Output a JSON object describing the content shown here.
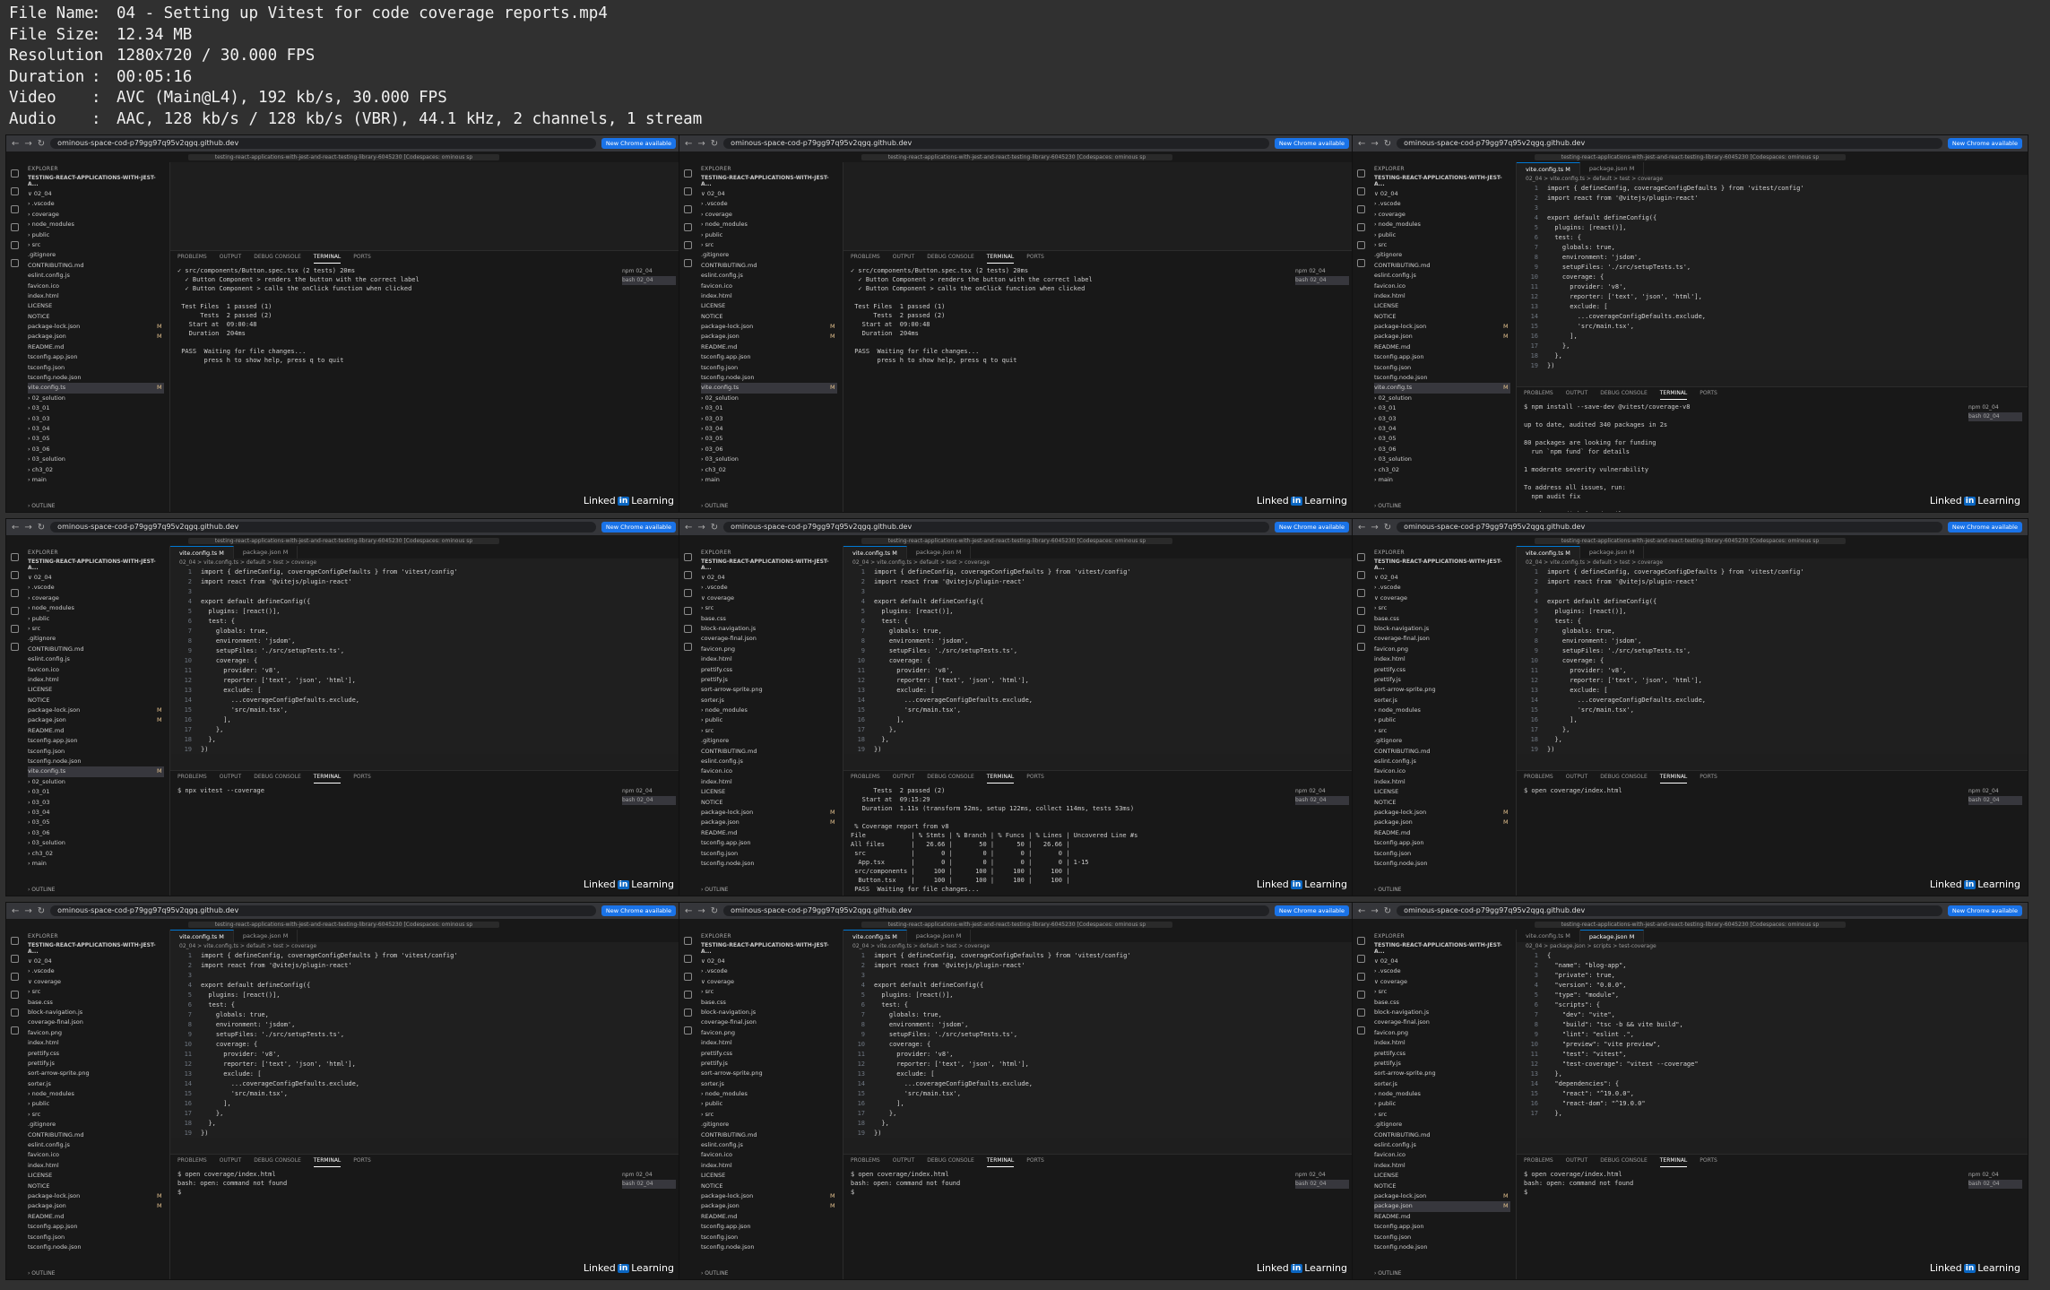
{
  "info": [
    {
      "key": "File Name",
      "value": "04 - Setting up Vitest for code coverage reports.mp4"
    },
    {
      "key": "File Size",
      "value": "12.34 MB"
    },
    {
      "key": "Resolution",
      "value": "1280x720 / 30.000 FPS"
    },
    {
      "key": "Duration",
      "value": "00:05:16"
    },
    {
      "key": "Video",
      "value": "AVC (Main@L4), 192 kb/s, 30.000 FPS"
    },
    {
      "key": "Audio",
      "value": "AAC, 128 kb/s / 128 kb/s (VBR), 44.1 kHz, 2 channels, 1 stream"
    }
  ],
  "separator": ":",
  "browser": {
    "url": "ominous-space-cod-p79gg97q95v2qgq.github.dev",
    "new_chrome_label": "New Chrome available",
    "codespace_title": "testing-react-applications-with-jest-and-react-testing-library-6045230 [Codespaces: ominous sp"
  },
  "watermark": {
    "pre": "Linked",
    "in": "in",
    "post": "Learning"
  },
  "explorer_header": "EXPLORER",
  "explorer_root": "TESTING-REACT-APPLICATIONS-WITH-JEST-A...",
  "outline_label": "OUTLINE",
  "panel_tabs": [
    "PROBLEMS",
    "OUTPUT",
    "DEBUG CONSOLE",
    "TERMINAL",
    "PORTS"
  ],
  "tree_root": [
    {
      "label": "∨ 02_04",
      "m": ""
    },
    {
      "label": "  › .vscode",
      "m": ""
    },
    {
      "label": "  › coverage",
      "m": ""
    },
    {
      "label": "  › node_modules",
      "m": ""
    },
    {
      "label": "  › public",
      "m": ""
    },
    {
      "label": "  › src",
      "m": ""
    },
    {
      "label": "    .gitignore",
      "m": ""
    },
    {
      "label": "    CONTRIBUTING.md",
      "m": ""
    },
    {
      "label": "    eslint.config.js",
      "m": ""
    },
    {
      "label": "    favicon.ico",
      "m": ""
    },
    {
      "label": "    index.html",
      "m": ""
    },
    {
      "label": "    LICENSE",
      "m": ""
    },
    {
      "label": "    NOTICE",
      "m": ""
    },
    {
      "label": "    package-lock.json",
      "m": "M"
    },
    {
      "label": "    package.json",
      "m": "M"
    },
    {
      "label": "    README.md",
      "m": ""
    },
    {
      "label": "    tsconfig.app.json",
      "m": ""
    },
    {
      "label": "    tsconfig.json",
      "m": ""
    },
    {
      "label": "    tsconfig.node.json",
      "m": ""
    },
    {
      "label": "    vite.config.ts",
      "m": "M"
    },
    {
      "label": "› 02_solution",
      "m": ""
    },
    {
      "label": "› 03_01",
      "m": ""
    },
    {
      "label": "› 03_03",
      "m": ""
    },
    {
      "label": "› 03_04",
      "m": ""
    },
    {
      "label": "› 03_05",
      "m": ""
    },
    {
      "label": "› 03_06",
      "m": ""
    },
    {
      "label": "› 03_solution",
      "m": ""
    },
    {
      "label": "› ch3_02",
      "m": ""
    },
    {
      "label": "› main",
      "m": ""
    }
  ],
  "tree_coverage": [
    {
      "label": "∨ 02_04",
      "m": ""
    },
    {
      "label": "  › .vscode",
      "m": ""
    },
    {
      "label": "  ∨ coverage",
      "m": ""
    },
    {
      "label": "    › src",
      "m": ""
    },
    {
      "label": "      base.css",
      "m": ""
    },
    {
      "label": "      block-navigation.js",
      "m": ""
    },
    {
      "label": "      coverage-final.json",
      "m": ""
    },
    {
      "label": "      favicon.png",
      "m": ""
    },
    {
      "label": "      index.html",
      "m": ""
    },
    {
      "label": "      prettify.css",
      "m": ""
    },
    {
      "label": "      prettify.js",
      "m": ""
    },
    {
      "label": "      sort-arrow-sprite.png",
      "m": ""
    },
    {
      "label": "      sorter.js",
      "m": ""
    },
    {
      "label": "  › node_modules",
      "m": ""
    },
    {
      "label": "  › public",
      "m": ""
    },
    {
      "label": "  › src",
      "m": ""
    },
    {
      "label": "    .gitignore",
      "m": ""
    },
    {
      "label": "    CONTRIBUTING.md",
      "m": ""
    },
    {
      "label": "    eslint.config.js",
      "m": ""
    },
    {
      "label": "    favicon.ico",
      "m": ""
    },
    {
      "label": "    index.html",
      "m": ""
    },
    {
      "label": "    LICENSE",
      "m": ""
    },
    {
      "label": "    NOTICE",
      "m": ""
    },
    {
      "label": "    package-lock.json",
      "m": "M"
    },
    {
      "label": "    package.json",
      "m": "M"
    },
    {
      "label": "    README.md",
      "m": ""
    },
    {
      "label": "    tsconfig.app.json",
      "m": ""
    },
    {
      "label": "    tsconfig.json",
      "m": ""
    },
    {
      "label": "    tsconfig.node.json",
      "m": ""
    }
  ],
  "vite_code": [
    "import { defineConfig, coverageConfigDefaults } from 'vitest/config'",
    "import react from '@vitejs/plugin-react'",
    "",
    "export default defineConfig({",
    "  plugins: [react()],",
    "  test: {",
    "    globals: true,",
    "    environment: 'jsdom',",
    "    setupFiles: './src/setupTests.ts',",
    "    coverage: {",
    "      provider: 'v8',",
    "      reporter: ['text', 'json', 'html'],",
    "      exclude: [",
    "        ...coverageConfigDefaults.exclude,",
    "        'src/main.tsx',",
    "      ],",
    "    },",
    "  },",
    "})"
  ],
  "package_code": [
    "{",
    "  \"name\": \"blog-app\",",
    "  \"private\": true,",
    "  \"version\": \"0.0.0\",",
    "  \"type\": \"module\",",
    "  \"scripts\": {",
    "    \"dev\": \"vite\",",
    "    \"build\": \"tsc -b && vite build\",",
    "    \"lint\": \"eslint .\",",
    "    \"preview\": \"vite preview\",",
    "    \"test\": \"vitest\",",
    "    \"test-coverage\": \"vitest --coverage\"",
    "  },",
    "  \"dependencies\": {",
    "    \"react\": \"^19.0.0\",",
    "    \"react-dom\": \"^19.0.0\"",
    "  },"
  ],
  "test_run": [
    "✓ src/components/Button.spec.tsx (2 tests) 20ms",
    "  ✓ Button Component > renders the button with the correct label",
    "  ✓ Button Component > calls the onClick function when clicked",
    "",
    " Test Files  1 passed (1)",
    "      Tests  2 passed (2)",
    "   Start at  09:00:48",
    "   Duration  204ms",
    "",
    " PASS  Waiting for file changes...",
    "       press h to show help, press q to quit"
  ],
  "npm_install": [
    "$ npm install --save-dev @vitest/coverage-v8",
    "",
    "up to date, audited 340 packages in 2s",
    "",
    "80 packages are looking for funding",
    "  run `npm fund` for details",
    "",
    "1 moderate severity vulnerability",
    "",
    "To address all issues, run:",
    "  npm audit fix",
    "",
    "Run `npm audit` for details.",
    "$"
  ],
  "npx_cmd": [
    "$ npx vitest --coverage"
  ],
  "coverage_report": [
    "      Tests  2 passed (2)",
    "   Start at  09:15:29",
    "   Duration  1.11s (transform 52ms, setup 122ms, collect 114ms, tests 53ms)",
    "",
    " % Coverage report from v8",
    "File            | % Stmts | % Branch | % Funcs | % Lines | Uncovered Line #s",
    "All files       |   26.66 |       50 |      50 |   26.66 |",
    " src            |       0 |        0 |       0 |       0 |",
    "  App.tsx       |       0 |        0 |       0 |       0 | 1-15",
    " src/components |     100 |      100 |     100 |     100 |",
    "  Button.tsx    |     100 |      100 |     100 |     100 |",
    " PASS  Waiting for file changes..."
  ],
  "open_cmd": [
    "$ open coverage/index.html"
  ],
  "open_fail": [
    "$ open coverage/index.html",
    "bash: open: command not found",
    "$"
  ],
  "tabs": {
    "vite": "vite.config.ts",
    "pkg": "package.json",
    "m": "M"
  },
  "crumb_vite": "02_04 > vite.config.ts > default > test > coverage",
  "crumb_pkg": "02_04 > package.json > scripts > test-coverage",
  "term_side": [
    "npm 02_04",
    "bash 02_04"
  ]
}
